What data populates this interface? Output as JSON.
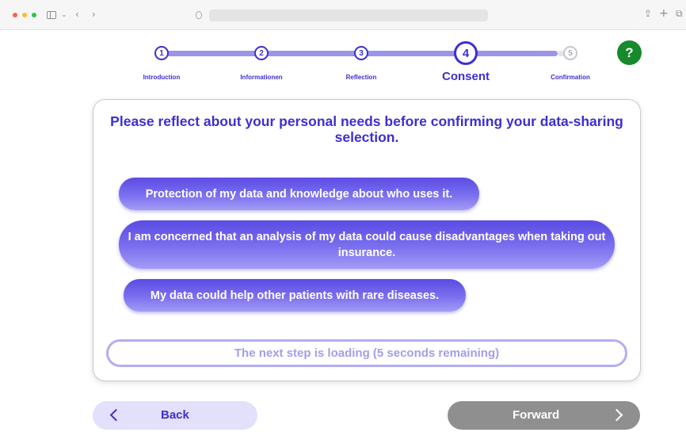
{
  "stepper": {
    "steps": [
      {
        "number": "1",
        "label": "Introduction",
        "state": "done"
      },
      {
        "number": "2",
        "label": "Informationen",
        "state": "done"
      },
      {
        "number": "3",
        "label": "Reflection",
        "state": "done"
      },
      {
        "number": "4",
        "label": "Consent",
        "state": "current"
      },
      {
        "number": "5",
        "label": "Confirmation",
        "state": "future"
      }
    ]
  },
  "help_button": {
    "label": "?",
    "icon": "help-icon",
    "color": "#178a2c"
  },
  "card": {
    "prompt": "Please reflect about your personal needs before confirming your data-sharing selection.",
    "options": [
      "Protection of my data and knowledge about who uses it.",
      "I am concerned that an analysis of my data could cause disadvantages when taking out insurance.",
      "My data could help other patients with rare diseases."
    ],
    "loading_text": "The next step is loading (5 seconds remaining)"
  },
  "nav": {
    "back_label": "Back",
    "forward_label": "Forward"
  },
  "colors": {
    "accent": "#3d2fd0",
    "pill": "#6c5fe8",
    "forward_disabled": "#8f8f8f",
    "back_bg": "#e2e0fa"
  }
}
